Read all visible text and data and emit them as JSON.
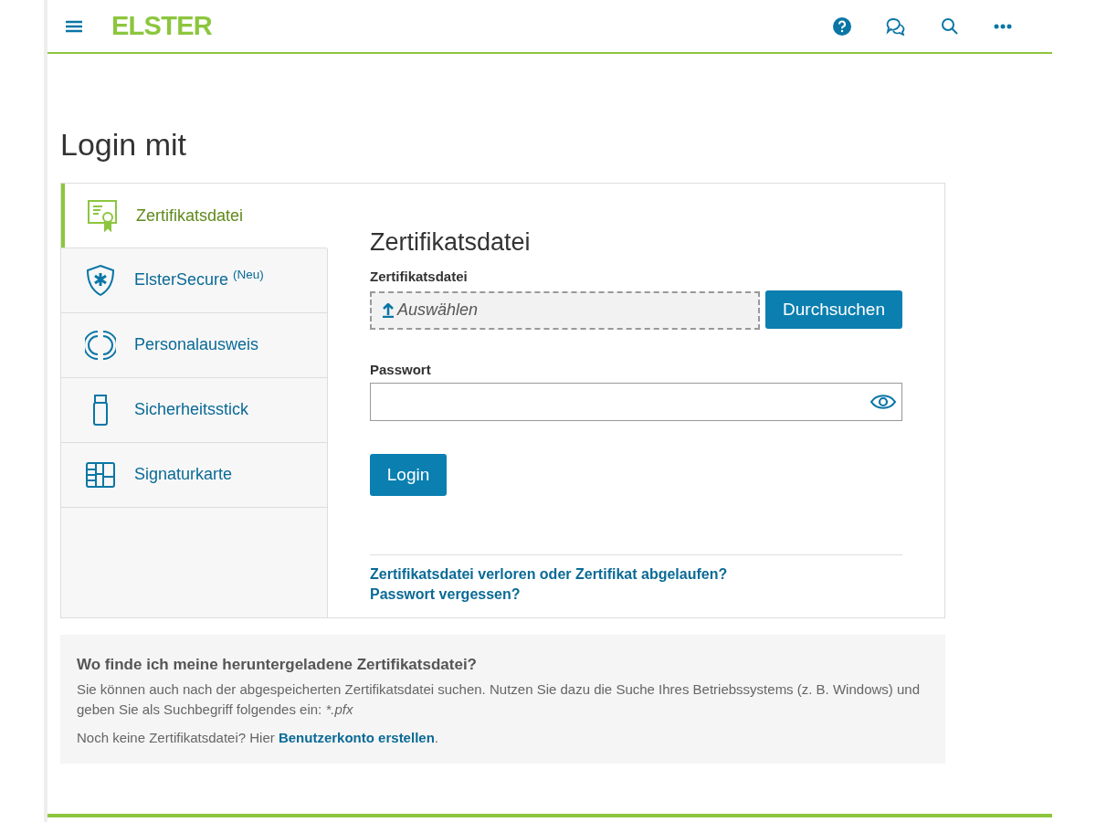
{
  "header": {
    "logo": "ELSTER"
  },
  "page_title": "Login mit",
  "methods": [
    {
      "label": "Zertifikatsdatei",
      "kind": "certificate",
      "selected": true
    },
    {
      "label": "ElsterSecure $^{(Neu)}$",
      "kind": "shield",
      "selected": false
    },
    {
      "label": "Personalausweis",
      "kind": "idcard",
      "selected": false
    },
    {
      "label": "Sicherheitsstick",
      "kind": "stick",
      "selected": false
    },
    {
      "label": "Signaturkarte",
      "kind": "chipcard",
      "selected": false
    }
  ],
  "form": {
    "title": "Zertifikatsdatei",
    "file_label": "Zertifikatsdatei",
    "file_placeholder": "Auswählen",
    "browse_button": "Durchsuchen",
    "password_label": "Passwort",
    "login_button": "Login",
    "links": [
      "Zertifikatsdatei verloren oder Zertifikat abgelaufen?",
      "Passwort vergessen?"
    ]
  },
  "info": {
    "title": "Wo finde ich meine heruntergeladene Zertifikatsdatei?",
    "text": "Sie können auch nach der abgespeicherten Zertifikatsdatei suchen. Nutzen Sie dazu die Suche Ihres Betriebssystems (z. B. Windows) und geben Sie als Suchbegriff folgendes ein:",
    "pattern": "*.pfx",
    "register_prefix": "Noch keine Zertifikatsdatei? Hier",
    "register_link": "Benutzerkonto erstellen",
    "register_suffix": "."
  }
}
